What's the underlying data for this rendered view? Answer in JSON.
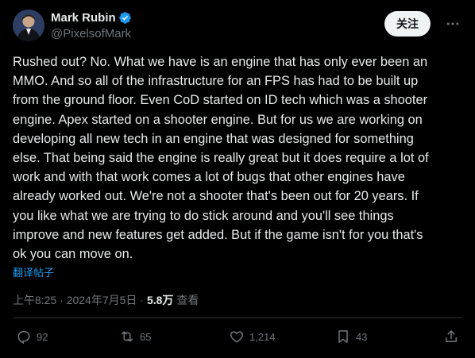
{
  "tweet": {
    "author": {
      "display_name": "Mark Rubin",
      "handle": "@PixelsofMark",
      "verified": true,
      "verified_color": "#1d9bf0"
    },
    "follow_label": "关注",
    "text": "Rushed out? No. What we have is an engine that has only ever been an\nMMO. And so all of the infrastructure for an FPS has had to be built up\nfrom the ground floor. Even CoD started on ID tech which was a shooter\nengine. Apex started on a shooter engine. But for us we are working on\ndeveloping all new tech in an engine that was designed for something\nelse. That being said the engine is really great but it does require a lot of\nwork and with that work comes a lot of bugs that other engines have\nalready worked out. We're not a shooter that's been out for 20 years. If\nyou like what we are trying to do stick around and you'll see things\nimprove and new features get added. But if the game isn't for you that's\nok you can move on.",
    "translate_label": "翻译帖子",
    "timestamp": "上午8:25 · 2024年7月5日 ·",
    "views_count": "5.8万",
    "views_label": "查看"
  },
  "actions": {
    "replies": "92",
    "reposts": "65",
    "likes": "1,214",
    "bookmarks": "43"
  },
  "icons": {
    "more": "more-dots-icon",
    "reply": "reply-bubble-icon",
    "repost": "repost-icon",
    "like": "heart-icon",
    "bookmark": "bookmark-icon",
    "share": "share-icon",
    "verified": "verified-badge-icon"
  },
  "colors": {
    "background": "#000000",
    "text": "#e7e9ea",
    "muted": "#71767b",
    "link": "#1d9bf0",
    "button_bg": "#eff3f4"
  }
}
